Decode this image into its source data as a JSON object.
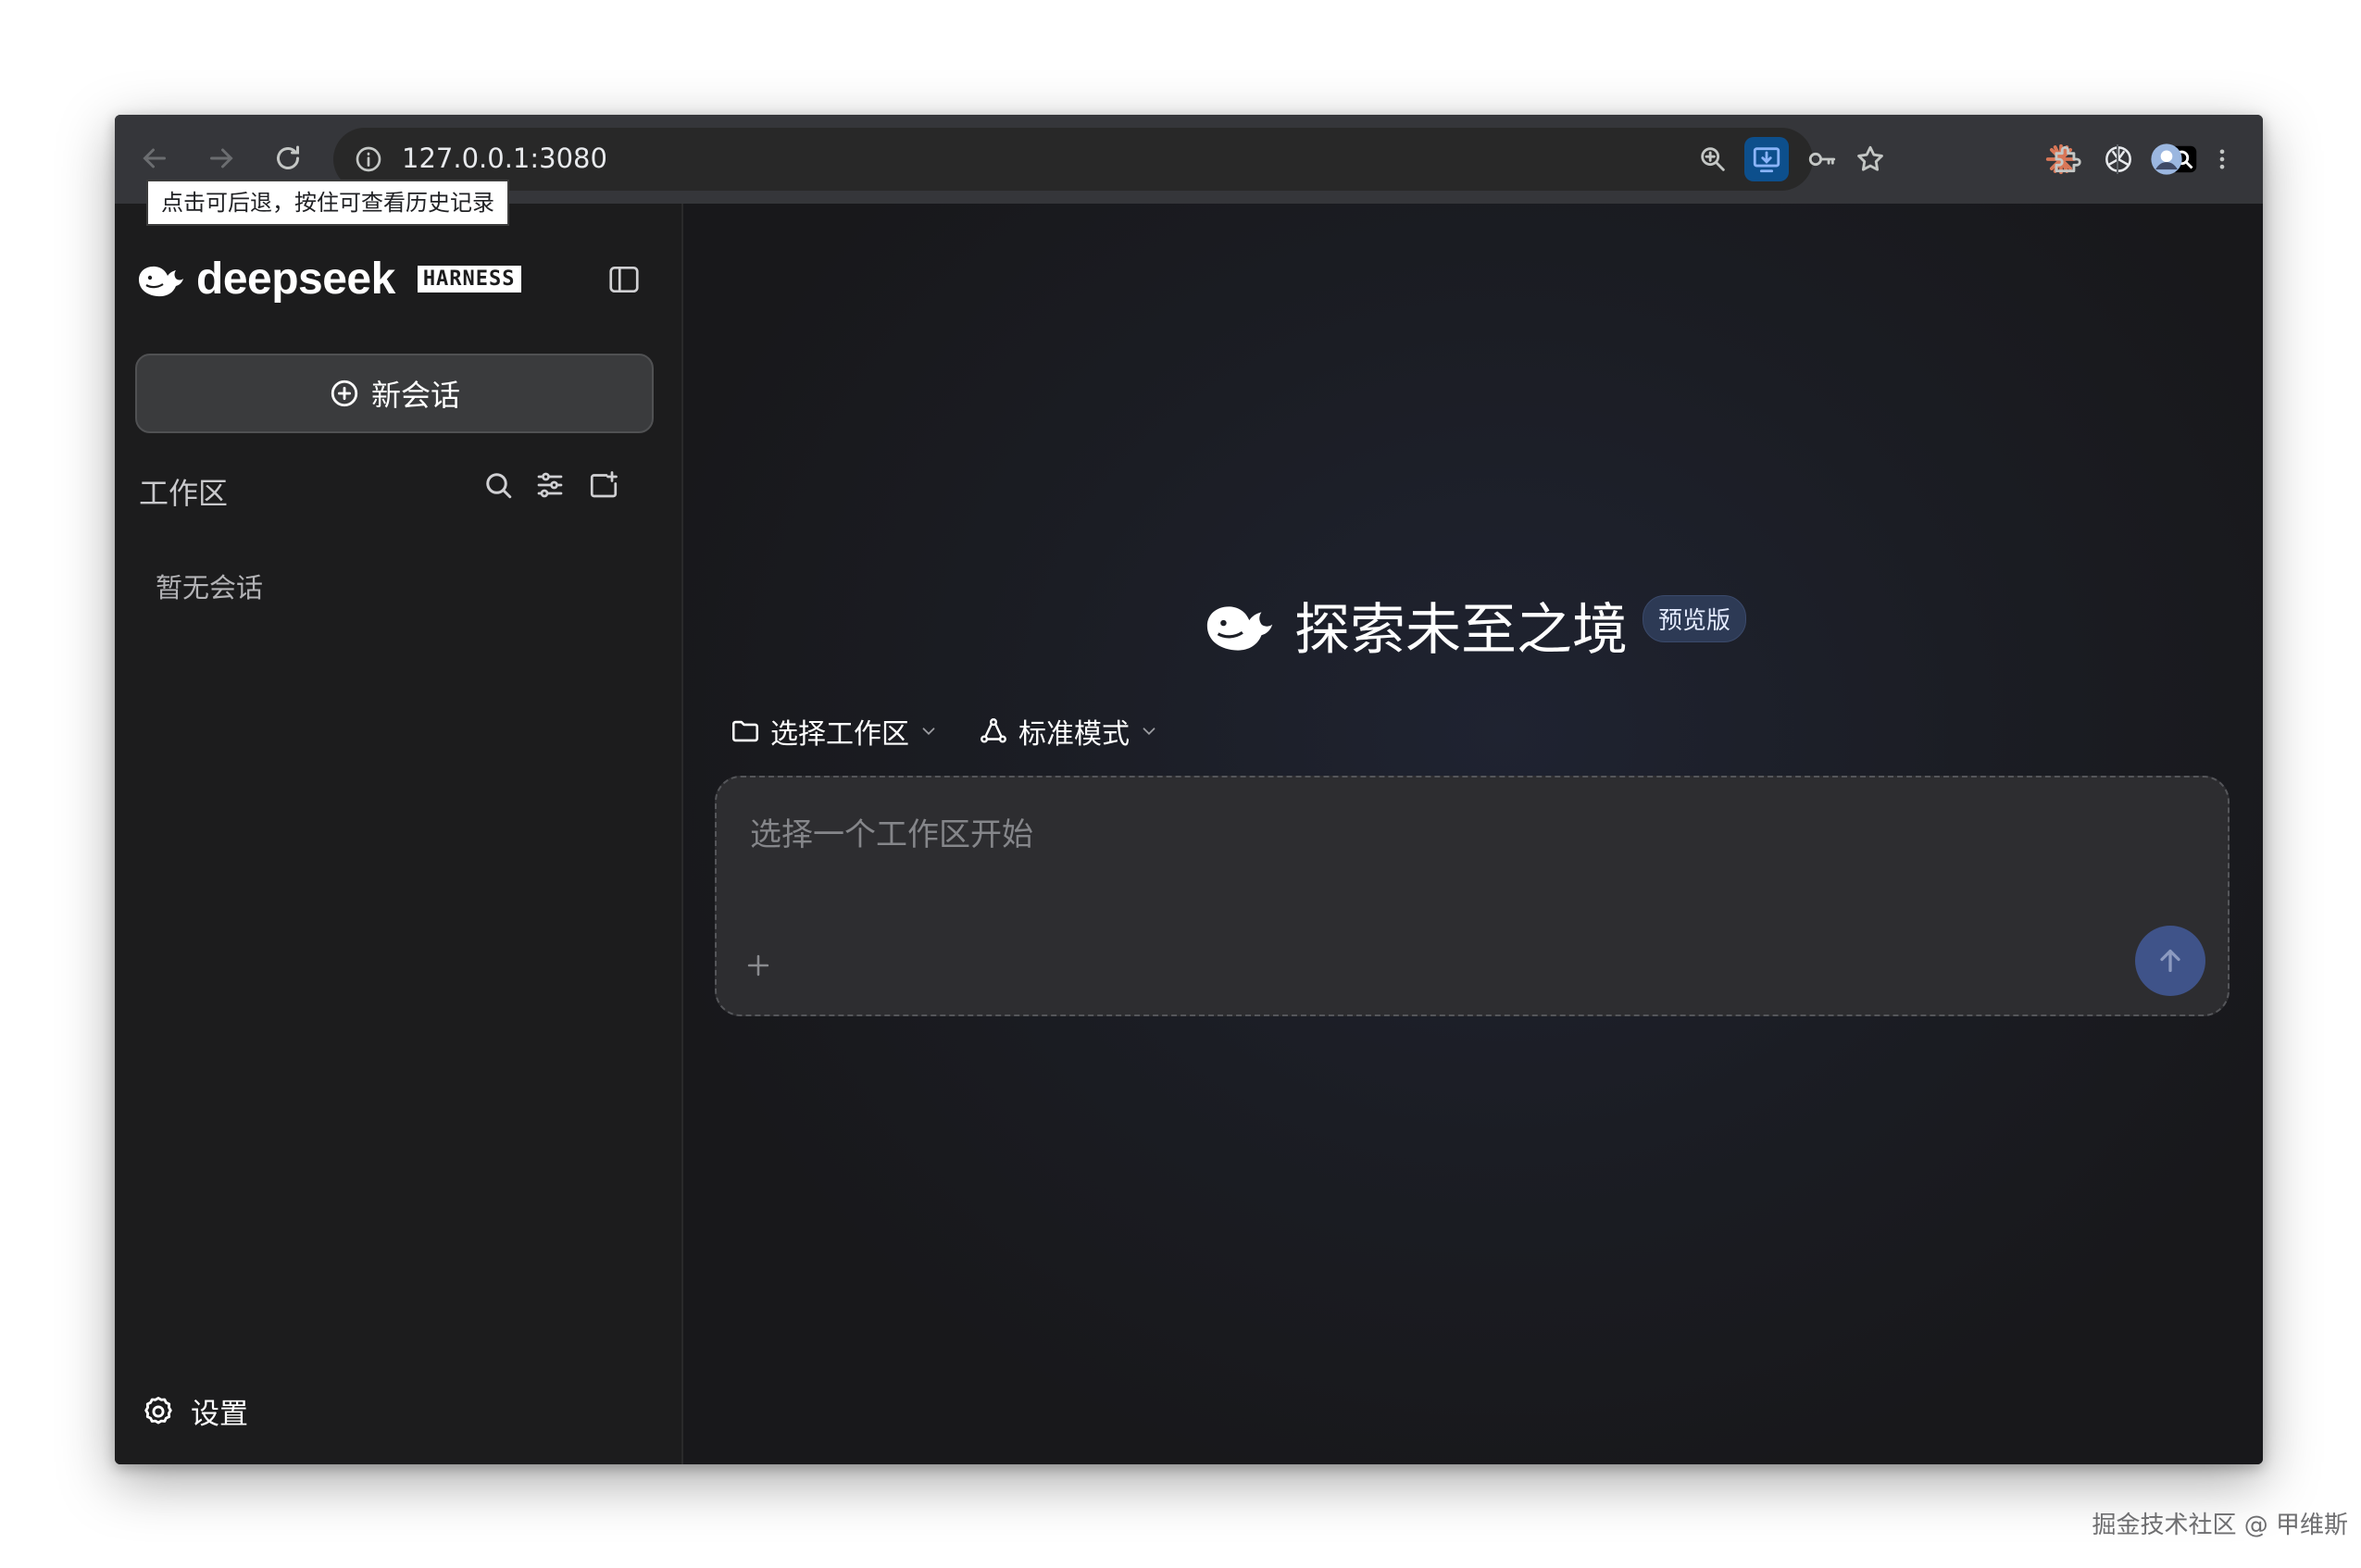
{
  "browser": {
    "url": "127.0.0.1:3080",
    "tooltip": "点击可后退，按住可查看历史记录"
  },
  "sidebar": {
    "brand": "deepseek",
    "brand_tag": "HARNESS",
    "new_chat_label": "新会话",
    "workspace_title": "工作区",
    "empty_text": "暂无会话",
    "settings_label": "设置"
  },
  "main": {
    "hero_title": "探索未至之境",
    "preview_badge": "预览版",
    "workspace_selector": "选择工作区",
    "mode_selector": "标准模式",
    "input_placeholder": "选择一个工作区开始"
  },
  "watermark": "掘金技术社区 @ 甲维斯",
  "colors": {
    "accent_send": "#3f5389",
    "badge_bg": "#2d3a55",
    "active_ext": "#0d4f8c"
  },
  "icons": {
    "back": "arrow-left-icon",
    "forward": "arrow-right-icon",
    "reload": "reload-icon",
    "site_info": "info-icon",
    "zoom": "zoom-icon",
    "install": "install-app-icon",
    "password": "key-icon",
    "bookmark": "star-icon",
    "claude": "claude-sparkle-icon",
    "openai": "openai-icon",
    "extension": "puzzle-icon",
    "menu": "kebab-icon"
  }
}
